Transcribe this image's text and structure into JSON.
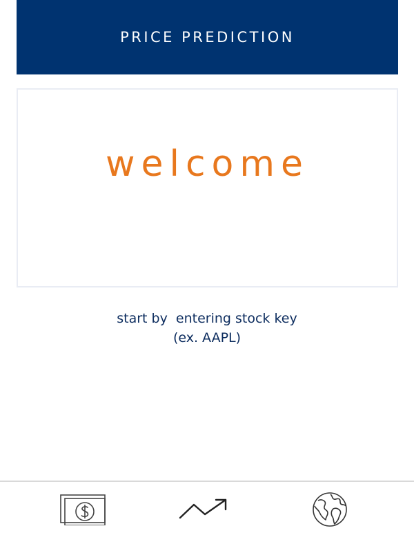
{
  "header": {
    "title": "PRICE PREDICTION"
  },
  "welcome": {
    "text": "welcome"
  },
  "instructions": {
    "line1": "start by  entering stock key",
    "line2": "(ex. AAPL)"
  },
  "tabbar": {
    "tabs": [
      {
        "icon": "dollar-bill-icon"
      },
      {
        "icon": "trending-up-icon"
      },
      {
        "icon": "globe-icon"
      }
    ]
  },
  "colors": {
    "header_bg": "#003370",
    "accent": "#e8781e",
    "text": "#0c2c5e"
  }
}
